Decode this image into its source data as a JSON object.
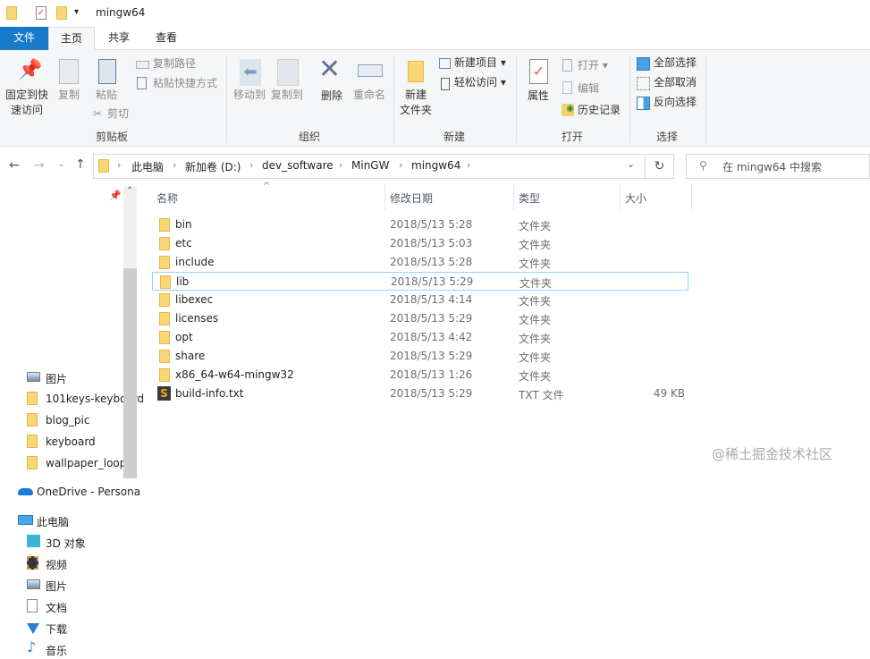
{
  "window": {
    "title": "mingw64"
  },
  "tabs": {
    "file": "文件",
    "home": "主页",
    "share": "共享",
    "view": "查看"
  },
  "ribbon": {
    "pin": "固定到快\n速访问",
    "copy": "复制",
    "paste": "粘贴",
    "copy_path": "复制路径",
    "paste_shortcut": "粘贴快捷方式",
    "cut": "剪切",
    "clipboard": "剪贴板",
    "move_to": "移动到",
    "copy_to": "复制到",
    "delete": "删除",
    "rename": "重命名",
    "organize": "组织",
    "new_folder": "新建\n文件夹",
    "new_item": "新建项目",
    "easy_access": "轻松访问",
    "new": "新建",
    "properties": "属性",
    "open": "打开",
    "edit": "编辑",
    "history": "历史记录",
    "open_group": "打开",
    "select_all": "全部选择",
    "select_none": "全部取消",
    "invert": "反向选择",
    "select": "选择"
  },
  "address": {
    "crumbs": [
      "此电脑",
      "新加卷 (D:)",
      "dev_software",
      "MinGW",
      "mingw64"
    ]
  },
  "search": {
    "placeholder": "在 mingw64 中搜索"
  },
  "nav": [
    {
      "label": "图片",
      "icon": "pictures-icon"
    },
    {
      "label": "101keys-keyboard",
      "icon": "folder-icon"
    },
    {
      "label": "blog_pic",
      "icon": "folder-icon"
    },
    {
      "label": "keyboard",
      "icon": "folder-icon"
    },
    {
      "label": "wallpaper_loop",
      "icon": "folder-icon"
    },
    {
      "label": "OneDrive - Personal",
      "icon": "onedrive-icon"
    },
    {
      "label": "此电脑",
      "icon": "pc-icon"
    },
    {
      "label": "3D 对象",
      "icon": "3d-icon"
    },
    {
      "label": "视频",
      "icon": "video-icon"
    },
    {
      "label": "图片",
      "icon": "pictures-icon"
    },
    {
      "label": "文档",
      "icon": "documents-icon"
    },
    {
      "label": "下载",
      "icon": "download-icon"
    },
    {
      "label": "音乐",
      "icon": "music-icon"
    }
  ],
  "columns": {
    "name": "名称",
    "date": "修改日期",
    "type": "类型",
    "size": "大小"
  },
  "files": [
    {
      "name": "bin",
      "date": "2018/5/13 5:28",
      "type": "文件夹",
      "size": ""
    },
    {
      "name": "etc",
      "date": "2018/5/13 5:03",
      "type": "文件夹",
      "size": ""
    },
    {
      "name": "include",
      "date": "2018/5/13 5:28",
      "type": "文件夹",
      "size": ""
    },
    {
      "name": "lib",
      "date": "2018/5/13 5:29",
      "type": "文件夹",
      "size": ""
    },
    {
      "name": "libexec",
      "date": "2018/5/13 4:14",
      "type": "文件夹",
      "size": ""
    },
    {
      "name": "licenses",
      "date": "2018/5/13 5:29",
      "type": "文件夹",
      "size": ""
    },
    {
      "name": "opt",
      "date": "2018/5/13 4:42",
      "type": "文件夹",
      "size": ""
    },
    {
      "name": "share",
      "date": "2018/5/13 5:29",
      "type": "文件夹",
      "size": ""
    },
    {
      "name": "x86_64-w64-mingw32",
      "date": "2018/5/13 1:26",
      "type": "文件夹",
      "size": ""
    },
    {
      "name": "build-info.txt",
      "date": "2018/5/13 5:29",
      "type": "TXT 文件",
      "size": "49 KB"
    }
  ],
  "selected_index": 3,
  "watermark": "@稀土掘金技术社区"
}
